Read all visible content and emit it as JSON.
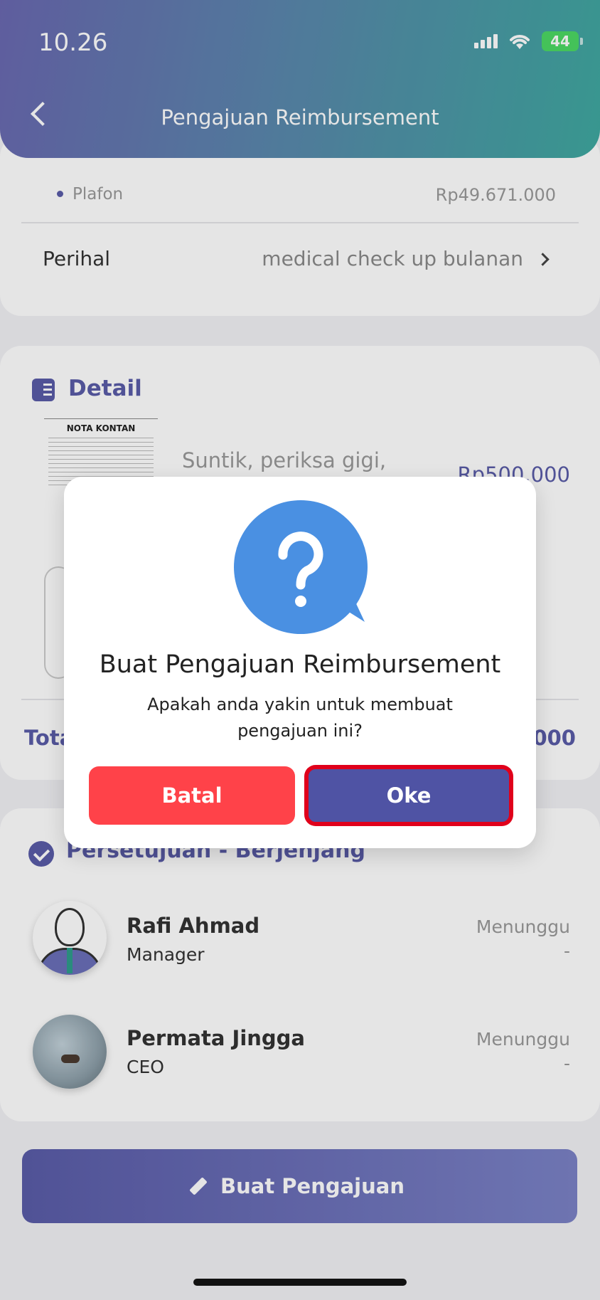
{
  "status_bar": {
    "time": "10.26",
    "battery": "44"
  },
  "header": {
    "title": "Pengajuan Reimbursement"
  },
  "summary": {
    "plafon_label": "Plafon",
    "plafon_value": "Rp49.671.000",
    "perihal_label": "Perihal",
    "perihal_value": "medical check up bulanan"
  },
  "detail": {
    "title": "Detail",
    "receipt_title": "NOTA KONTAN",
    "item_description": "Suntik, periksa gigi,",
    "item_amount": "Rp500.000",
    "total_label": "Tota",
    "total_value": ".000"
  },
  "approval": {
    "title": "Persetujuan - Berjenjang",
    "approvers": [
      {
        "name": "Rafi Ahmad",
        "role": "Manager",
        "status": "Menunggu",
        "date": "-"
      },
      {
        "name": "Permata Jingga",
        "role": "CEO",
        "status": "Menunggu",
        "date": "-"
      }
    ]
  },
  "submit_button": {
    "label": "Buat Pengajuan"
  },
  "dialog": {
    "title": "Buat Pengajuan Reimbursement",
    "message": "Apakah anda yakin untuk membuat pengajuan ini?",
    "cancel_label": "Batal",
    "ok_label": "Oke"
  },
  "colors": {
    "primary": "#5a5ca8",
    "danger": "#ff4249",
    "ok_button": "#4f53a4",
    "highlight_border": "#e0001b",
    "question_icon": "#4a90e2"
  }
}
